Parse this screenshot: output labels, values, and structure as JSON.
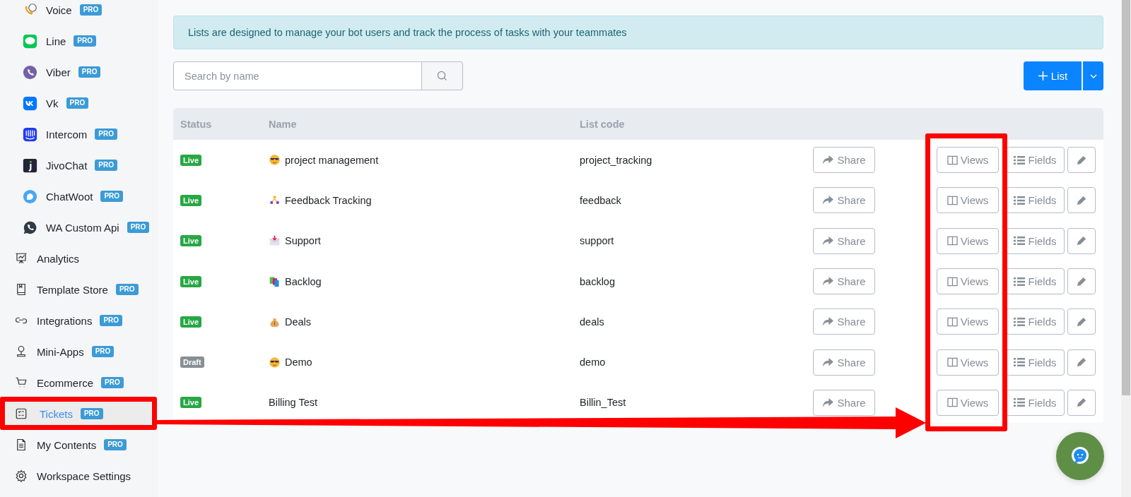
{
  "sidebar": {
    "channel_items": [
      {
        "label": "Voice",
        "kind": "voice",
        "badge": "PRO",
        "selected": false
      },
      {
        "label": "Line",
        "kind": "line",
        "badge": "PRO",
        "selected": false
      },
      {
        "label": "Viber",
        "kind": "viber",
        "badge": "PRO",
        "selected": false
      },
      {
        "label": "Vk",
        "kind": "vk",
        "badge": "PRO",
        "selected": false
      },
      {
        "label": "Intercom",
        "kind": "intercom",
        "badge": "PRO",
        "selected": false
      },
      {
        "label": "JivoChat",
        "kind": "jivo",
        "badge": "PRO",
        "selected": false
      },
      {
        "label": "ChatWoot",
        "kind": "chatwoot",
        "badge": "PRO",
        "selected": false
      },
      {
        "label": "WA Custom Api",
        "kind": "whatsapp",
        "badge": "PRO",
        "selected": false
      }
    ],
    "nav_items": [
      {
        "label": "Analytics",
        "kind": "analytics",
        "selected": false
      },
      {
        "label": "Template Store",
        "kind": "book",
        "badge": "PRO",
        "selected": false
      },
      {
        "label": "Integrations",
        "kind": "link",
        "badge": "PRO",
        "selected": false
      },
      {
        "label": "Mini-Apps",
        "kind": "pin",
        "badge": "PRO",
        "selected": false
      },
      {
        "label": "Ecommerce",
        "kind": "cart",
        "badge": "PRO",
        "selected": false
      },
      {
        "label": "Tickets",
        "kind": "tickets",
        "badge": "PRO",
        "selected": true
      },
      {
        "label": "My Contents",
        "kind": "document",
        "badge": "PRO",
        "selected": false
      },
      {
        "label": "Workspace Settings",
        "kind": "gear",
        "selected": false
      }
    ]
  },
  "alert": "Lists are designed to manage your bot users and track the process of tasks with your teammates",
  "search": {
    "placeholder": "Search by name"
  },
  "add_button": {
    "label": "List"
  },
  "table": {
    "columns": [
      "Status",
      "Name",
      "List code"
    ],
    "rows": [
      {
        "status": "Live",
        "color": "#28a745",
        "kind": "sunglasses",
        "name": "project management",
        "code": "project_tracking",
        "actions": [
          "Share",
          "Views",
          "Fields"
        ]
      },
      {
        "status": "Live",
        "color": "#28a745",
        "kind": "people",
        "name": "Feedback Tracking",
        "code": "feedback",
        "actions": [
          "Share",
          "Views",
          "Fields"
        ]
      },
      {
        "status": "Live",
        "color": "#28a745",
        "kind": "envelope",
        "name": "Support",
        "code": "support",
        "actions": [
          "Share",
          "Views",
          "Fields"
        ]
      },
      {
        "status": "Live",
        "color": "#28a745",
        "kind": "books",
        "name": "Backlog",
        "code": "backlog",
        "actions": [
          "Share",
          "Views",
          "Fields"
        ]
      },
      {
        "status": "Live",
        "color": "#28a745",
        "kind": "moneybag",
        "name": "Deals",
        "code": "deals",
        "actions": [
          "Share",
          "Views",
          "Fields"
        ]
      },
      {
        "status": "Draft",
        "color": "#868e96",
        "kind": "sunglasses",
        "name": "Demo",
        "code": "demo",
        "actions": [
          "Share",
          "Views",
          "Fields"
        ]
      },
      {
        "status": "Live",
        "color": "#28a745",
        "kind": "plain",
        "name": "Billing Test",
        "code": "Billin_Test",
        "actions": [
          "Share",
          "Views",
          "Fields"
        ]
      }
    ]
  }
}
